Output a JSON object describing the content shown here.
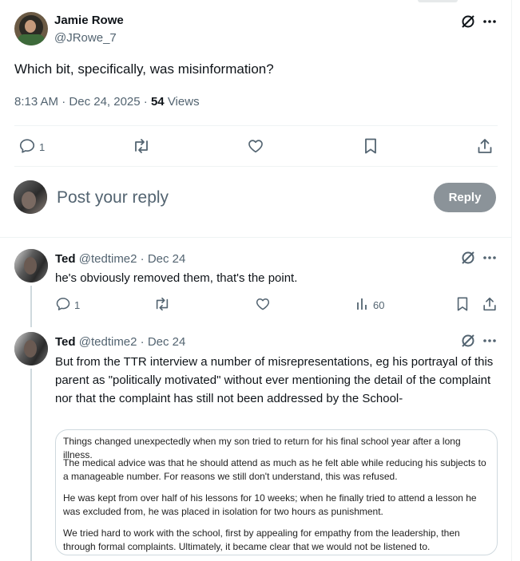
{
  "main_post": {
    "author_name": "Jamie Rowe",
    "author_handle": "@JRowe_7",
    "text": "Which bit, specifically, was misinformation?",
    "time": "8:13 AM",
    "date": "Dec 24, 2025",
    "views_count": "54",
    "views_label": "Views",
    "reply_count": "1"
  },
  "composer": {
    "placeholder": "Post your reply",
    "button_label": "Reply"
  },
  "replies": [
    {
      "name": "Ted",
      "handle": "@tedtime2",
      "date": "Dec 24",
      "text": "he's obviously removed them, that's the point.",
      "reply_count": "1",
      "views": "60"
    },
    {
      "name": "Ted",
      "handle": "@tedtime2",
      "date": "Dec 24",
      "text": "But from the TTR interview a number of misrepresentations, eg his portrayal of this parent as \"politically motivated\" without ever mentioning the detail of the complaint nor that the complaint has still not been addressed by the School-",
      "image_paragraphs": [
        "Things changed unexpectedly when my son tried to return for his final school year after a long illness.",
        "The medical advice was that he should attend as much as he felt able while reducing his subjects to a manageable number. For reasons we still don't understand, this was refused.",
        "He was kept from over half of his lessons for 10 weeks; when he finally tried to attend a lesson he was excluded from, he was placed in isolation for two hours as punishment.",
        "We tried hard to work with the school, first by appealing for empathy from the leadership, then through formal complaints. Ultimately, it became clear that we would not be listened to."
      ]
    }
  ],
  "icons": {
    "grok": "grok-icon",
    "more": "more-icon",
    "reply": "reply-icon",
    "repost": "repost-icon",
    "like": "like-icon",
    "views": "views-icon",
    "bookmark": "bookmark-icon",
    "share": "share-icon"
  },
  "colors": {
    "text": "#0f1419",
    "muted": "#536471",
    "divider": "#eff3f4",
    "reply_button": "#8b9399"
  }
}
